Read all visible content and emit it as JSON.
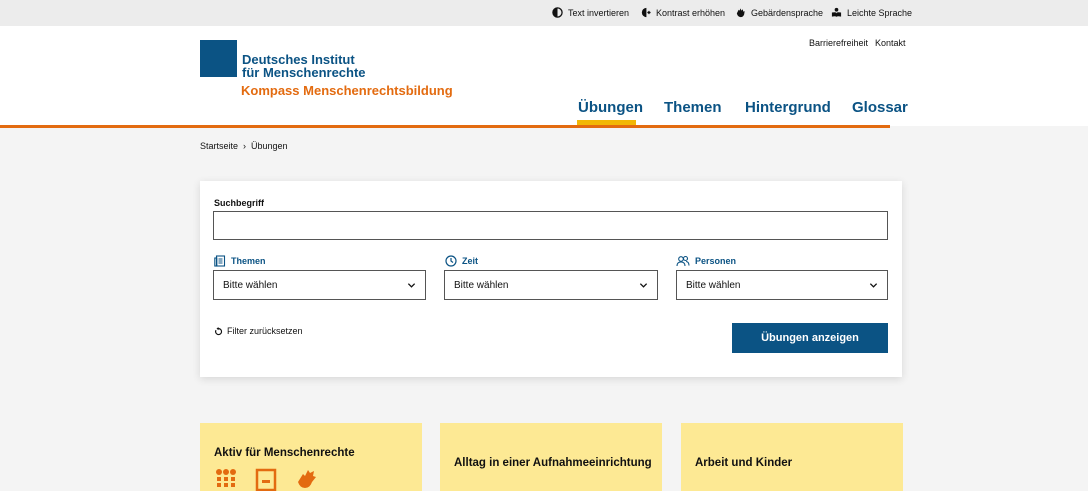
{
  "a11y_bar": {
    "items": [
      {
        "label": "Text invertieren",
        "icon": "invert-contrast-icon"
      },
      {
        "label": "Kontrast erhöhen",
        "icon": "contrast-increase-icon"
      },
      {
        "label": "Gebärdensprache",
        "icon": "sign-language-icon"
      },
      {
        "label": "Leichte Sprache",
        "icon": "easy-language-icon"
      }
    ]
  },
  "header": {
    "logo_line1": "Deutsches Institut",
    "logo_line2": "für Menschenrechte",
    "logo_sub": "Kompass Menschenrechtsbildung",
    "meta_links": [
      "Barrierefreiheit",
      "Kontakt"
    ],
    "nav": [
      {
        "label": "Übungen",
        "active": true
      },
      {
        "label": "Themen",
        "active": false
      },
      {
        "label": "Hintergrund",
        "active": false
      },
      {
        "label": "Glossar",
        "active": false
      }
    ]
  },
  "breadcrumb": {
    "items": [
      "Startseite",
      "Übungen"
    ]
  },
  "search": {
    "label": "Suchbegriff",
    "value": "",
    "filters": [
      {
        "label": "Themen",
        "icon": "topics-icon",
        "value": "Bitte wählen"
      },
      {
        "label": "Zeit",
        "icon": "clock-icon",
        "value": "Bitte wählen"
      },
      {
        "label": "Personen",
        "icon": "people-icon",
        "value": "Bitte wählen"
      }
    ],
    "reset_label": "Filter zurücksetzen",
    "submit_label": "Übungen anzeigen"
  },
  "cards": [
    {
      "title": "Aktiv für Menschenrechte"
    },
    {
      "title": "Alltag in einer Aufnahmeeinrichtung"
    },
    {
      "title": "Arbeit und Kinder"
    }
  ],
  "colors": {
    "brand_blue": "#0b5384",
    "brand_orange": "#e36b10",
    "nav_active": "#f2b705",
    "card_bg": "#fde994"
  }
}
